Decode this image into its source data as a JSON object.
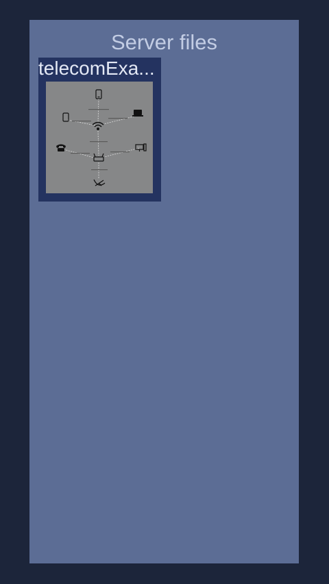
{
  "panel": {
    "title": "Server files"
  },
  "files": [
    {
      "name": "telecomExa...",
      "thumbnail_icon": "network-diagram-thumbnail"
    }
  ],
  "colors": {
    "background": "#1c253a",
    "panel": "#5c6d95",
    "tile": "#243360",
    "thumbnail": "#868788",
    "title_text": "#c3cde4"
  }
}
